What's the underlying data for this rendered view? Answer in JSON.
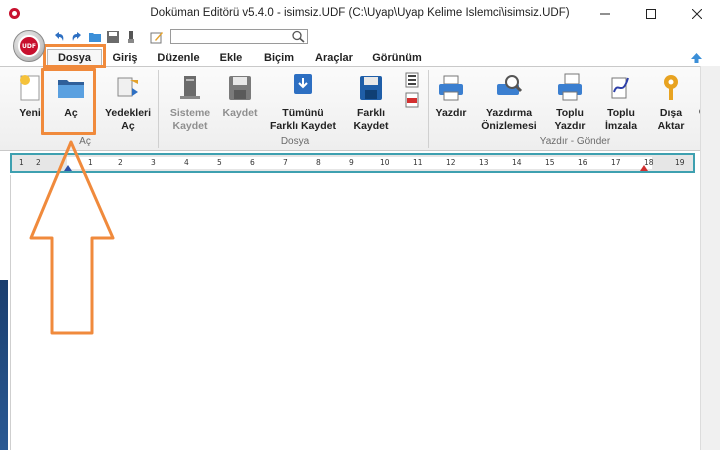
{
  "window": {
    "title": "Doküman Editörü v5.4.0 - isimsiz.UDF (C:\\Uyap\\Uyap Kelime Islemci\\isimsiz.UDF)",
    "logo_text": "UDF"
  },
  "quick_access": {
    "search_value": "",
    "icons": [
      "undo-icon",
      "redo-icon",
      "folder-icon",
      "save-icon",
      "attach-icon",
      "edit-icon"
    ]
  },
  "tabs": [
    {
      "label": "Dosya",
      "active": true
    },
    {
      "label": "Giriş",
      "active": false
    },
    {
      "label": "Düzenle",
      "active": false
    },
    {
      "label": "Ekle",
      "active": false
    },
    {
      "label": "Biçim",
      "active": false
    },
    {
      "label": "Araçlar",
      "active": false
    },
    {
      "label": "Görünüm",
      "active": false
    }
  ],
  "ribbon": {
    "groups": [
      {
        "label": "Aç"
      },
      {
        "label": "Dosya"
      },
      {
        "label": "Yazdır - Gönder"
      }
    ],
    "buttons": {
      "yeni": "Yeni",
      "ac": "Aç",
      "yedekleri_ac_1": "Yedekleri",
      "yedekleri_ac_2": "Aç",
      "sisteme_kaydet_1": "Sisteme",
      "sisteme_kaydet_2": "Kaydet",
      "kaydet": "Kaydet",
      "tumunu_1": "Tümünü",
      "tumunu_2": "Farklı Kaydet",
      "farkli_1": "Farklı",
      "farkli_2": "Kaydet",
      "yazdir": "Yazdır",
      "yazdirma_1": "Yazdırma",
      "yazdirma_2": "Önizlemesi",
      "toplu_yazdir_1": "Toplu",
      "toplu_yazdir_2": "Yazdır",
      "toplu_imzala_1": "Toplu",
      "toplu_imzala_2": "İmzala",
      "disa_aktar_1": "Dışa",
      "disa_aktar_2": "Aktar",
      "extra": "G"
    }
  },
  "ruler": {
    "labels": [
      "1",
      "2",
      "1",
      "2",
      "3",
      "4",
      "5",
      "6",
      "7",
      "8",
      "9",
      "10",
      "11",
      "12",
      "13",
      "14",
      "15",
      "16",
      "17",
      "18",
      "19"
    ]
  },
  "colors": {
    "annotation": "#f08a3c",
    "ruler_border": "#3ea0b0",
    "logo_red": "#c8102e"
  }
}
